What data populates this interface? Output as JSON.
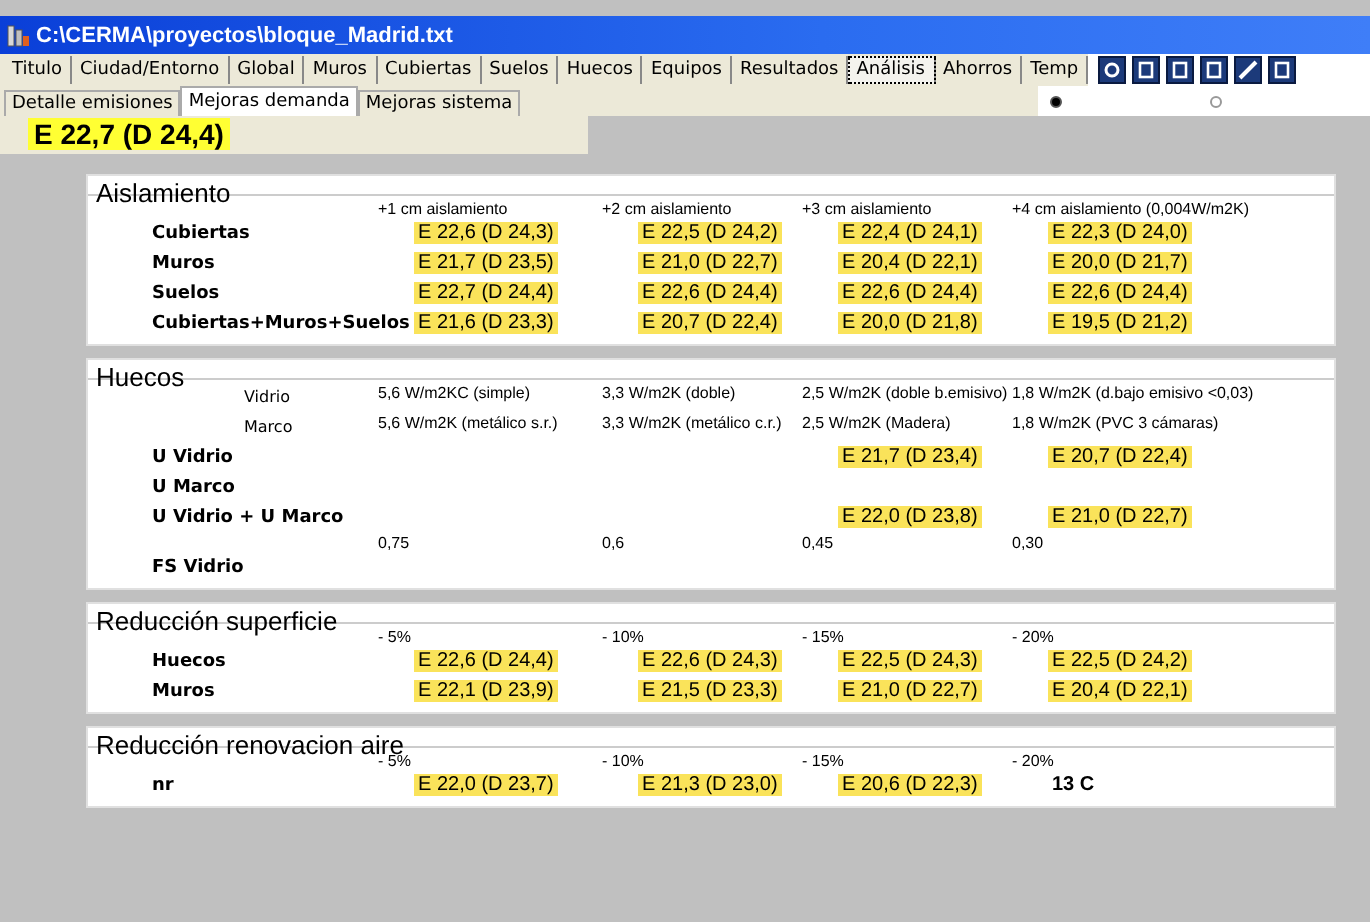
{
  "window": {
    "title": "C:\\CERMA\\proyectos\\bloque_Madrid.txt"
  },
  "tabs": [
    {
      "label": "Titulo",
      "selected": false
    },
    {
      "label": "Ciudad/Entorno",
      "selected": false
    },
    {
      "label": "Global",
      "selected": false
    },
    {
      "label": "Muros",
      "selected": false
    },
    {
      "label": "Cubiertas",
      "selected": false
    },
    {
      "label": "Suelos",
      "selected": false
    },
    {
      "label": "Huecos",
      "selected": false
    },
    {
      "label": "Equipos",
      "selected": false
    },
    {
      "label": "Resultados",
      "selected": false
    },
    {
      "label": "Análisis",
      "selected": true
    },
    {
      "label": "Ahorros",
      "selected": false
    },
    {
      "label": "Temp",
      "selected": false
    }
  ],
  "subtabs": [
    {
      "label": "Detalle emisiones",
      "selected": false
    },
    {
      "label": "Mejoras demanda",
      "selected": true
    },
    {
      "label": "Mejoras sistema",
      "selected": false
    }
  ],
  "radios": [
    {
      "selected": true
    },
    {
      "selected": false
    }
  ],
  "summary": "E 22,7 (D 24,4)",
  "sections": [
    {
      "title": "Aislamiento",
      "rows": [
        {
          "kind": "caption",
          "cells": [
            "+1 cm aislamiento",
            "+2 cm aislamiento",
            "+3 cm aislamiento",
            "+4 cm aislamiento  (0,004W/m2K)"
          ]
        },
        {
          "kind": "result",
          "label": "Cubiertas",
          "cells": [
            {
              "text": "E 22,6 (D 24,3)",
              "highlighted": true
            },
            {
              "text": "E 22,5 (D 24,2)",
              "highlighted": true
            },
            {
              "text": "E 22,4 (D 24,1)",
              "highlighted": true
            },
            {
              "text": "E 22,3 (D 24,0)",
              "highlighted": true
            }
          ]
        },
        {
          "kind": "result",
          "label": "Muros",
          "cells": [
            {
              "text": "E 21,7 (D 23,5)",
              "highlighted": true
            },
            {
              "text": "E 21,0 (D 22,7)",
              "highlighted": true
            },
            {
              "text": "E 20,4 (D 22,1)",
              "highlighted": true
            },
            {
              "text": "E 20,0 (D 21,7)",
              "highlighted": true
            }
          ]
        },
        {
          "kind": "result",
          "label": "Suelos",
          "cells": [
            {
              "text": "E 22,7 (D 24,4)",
              "highlighted": true
            },
            {
              "text": "E 22,6 (D 24,4)",
              "highlighted": true
            },
            {
              "text": "E 22,6 (D 24,4)",
              "highlighted": true
            },
            {
              "text": "E 22,6 (D 24,4)",
              "highlighted": true
            }
          ]
        },
        {
          "kind": "result",
          "label": "Cubiertas+Muros+Suelos",
          "cells": [
            {
              "text": "E 21,6 (D 23,3)",
              "highlighted": true
            },
            {
              "text": "E 20,7 (D 22,4)",
              "highlighted": true
            },
            {
              "text": "E 20,0 (D 21,8)",
              "highlighted": true
            },
            {
              "text": "E 19,5 (D 21,2)",
              "highlighted": true
            }
          ]
        }
      ]
    },
    {
      "title": "Huecos",
      "rows": [
        {
          "kind": "caption",
          "label": "Vidrio",
          "cells": [
            "5,6 W/m2KC (simple)",
            "3,3 W/m2K (doble)",
            "2,5 W/m2K  (doble b.emisivo)",
            "1,8 W/m2K (d.bajo emisivo <0,03)"
          ]
        },
        {
          "kind": "caption",
          "label": "Marco",
          "cells": [
            "5,6 W/m2K (metálico s.r.)",
            "3,3 W/m2K (metálico c.r.)",
            "2,5 W/m2K (Madera)",
            "1,8 W/m2K (PVC 3 cámaras)"
          ]
        },
        {
          "kind": "result",
          "label": "U Vidrio",
          "cells": [
            null,
            null,
            {
              "text": "E 21,7 (D 23,4)",
              "highlighted": true
            },
            {
              "text": "E 20,7 (D 22,4)",
              "highlighted": true
            }
          ]
        },
        {
          "kind": "result",
          "label": "U Marco",
          "cells": [
            null,
            null,
            null,
            null
          ]
        },
        {
          "kind": "result",
          "label": "U Vidrio + U Marco",
          "cells": [
            null,
            null,
            {
              "text": "E 22,0 (D 23,8)",
              "highlighted": true
            },
            {
              "text": "E 21,0 (D 22,7)",
              "highlighted": true
            }
          ]
        },
        {
          "kind": "caption",
          "cells": [
            "0,75",
            "0,6",
            "0,45",
            "0,30"
          ]
        },
        {
          "kind": "result",
          "label": "FS Vidrio",
          "cells": [
            null,
            null,
            null,
            null
          ]
        }
      ]
    },
    {
      "title": "Reducción superficie",
      "rows": [
        {
          "kind": "caption",
          "cells": [
            "- 5%",
            "- 10%",
            "- 15%",
            "- 20%"
          ]
        },
        {
          "kind": "result",
          "label": "Huecos",
          "cells": [
            {
              "text": "E 22,6 (D 24,4)",
              "highlighted": true
            },
            {
              "text": "E 22,6 (D 24,3)",
              "highlighted": true
            },
            {
              "text": "E 22,5 (D 24,3)",
              "highlighted": true
            },
            {
              "text": "E 22,5 (D 24,2)",
              "highlighted": true
            }
          ]
        },
        {
          "kind": "result",
          "label": "Muros",
          "cells": [
            {
              "text": "E 22,1 (D 23,9)",
              "highlighted": true
            },
            {
              "text": "E 21,5 (D 23,3)",
              "highlighted": true
            },
            {
              "text": "E 21,0 (D 22,7)",
              "highlighted": true
            },
            {
              "text": "E 20,4 (D 22,1)",
              "highlighted": true
            }
          ]
        }
      ]
    },
    {
      "title": "Reducción renovacion aire",
      "rows": [
        {
          "kind": "caption",
          "cells": [
            "- 5%",
            "- 10%",
            "- 15%",
            "- 20%"
          ]
        },
        {
          "kind": "result",
          "label": "nr",
          "cells": [
            {
              "text": "E 22,0 (D 23,7)",
              "highlighted": true
            },
            {
              "text": "E 21,3 (D 23,0)",
              "highlighted": true
            },
            {
              "text": "E 20,6 (D 22,3)",
              "highlighted": true
            },
            {
              "text": "13 C",
              "highlighted": false
            }
          ]
        }
      ]
    }
  ]
}
